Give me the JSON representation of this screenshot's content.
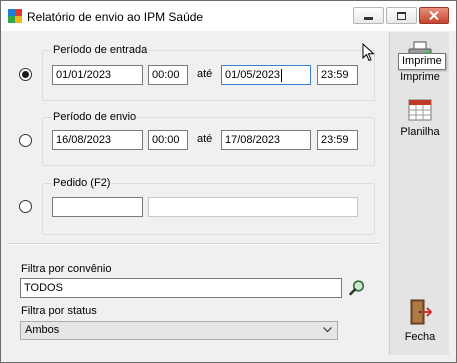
{
  "window": {
    "title": "Relatório de envio ao IPM Saúde",
    "icon_colors": [
      "#1f7ed6",
      "#e23a2e",
      "#30a84a",
      "#f2b31c"
    ]
  },
  "periodo_entrada": {
    "label": "Período de entrada",
    "selected": true,
    "date_from": "01/01/2023",
    "time_from": "00:00",
    "separator": "até",
    "date_to": "01/05/2023",
    "time_to": "23:59"
  },
  "periodo_envio": {
    "label": "Período de envio",
    "selected": false,
    "date_from": "16/08/2023",
    "time_from": "00:00",
    "separator": "até",
    "date_to": "17/08/2023",
    "time_to": "23:59"
  },
  "pedido": {
    "label": "Pedido (F2)",
    "selected": false,
    "number_value": "",
    "description_value": ""
  },
  "filtro_convenio": {
    "label": "Filtra por convênio",
    "value": "TODOS",
    "search_icon": "magnifier-icon"
  },
  "filtro_status": {
    "label": "Filtra por status",
    "selected": "Ambos",
    "arrow_icon": "chevron-down-icon"
  },
  "toolbar": {
    "imprime_label": "Imprime",
    "imprime_icon": "printer-icon",
    "planilha_label": "Planilha",
    "planilha_icon": "spreadsheet-icon",
    "fecha_label": "Fecha",
    "fecha_icon": "exit-door-icon",
    "tooltip": "Imprime"
  },
  "colors": {
    "focus_border": "#3a7fcf",
    "close_button": "#c7452f",
    "toolbar_bg": "#e4e4e4"
  }
}
